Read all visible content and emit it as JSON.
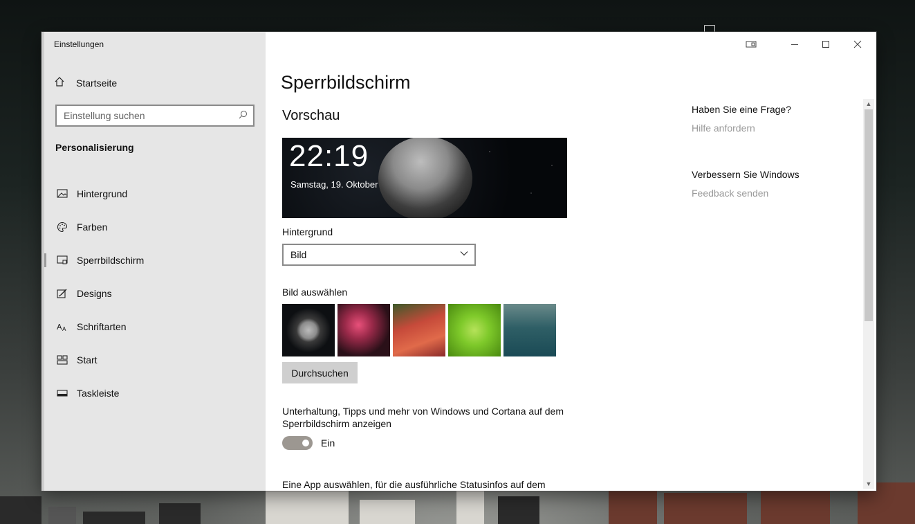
{
  "window": {
    "app_title": "Einstellungen"
  },
  "sidebar": {
    "home_label": "Startseite",
    "search_placeholder": "Einstellung suchen",
    "section_title": "Personalisierung",
    "items": [
      {
        "label": "Hintergrund",
        "icon": "picture-icon",
        "active": false
      },
      {
        "label": "Farben",
        "icon": "palette-icon",
        "active": false
      },
      {
        "label": "Sperrbildschirm",
        "icon": "lock-screen-icon",
        "active": true
      },
      {
        "label": "Designs",
        "icon": "brush-icon",
        "active": false
      },
      {
        "label": "Schriftarten",
        "icon": "font-icon",
        "active": false
      },
      {
        "label": "Start",
        "icon": "start-grid-icon",
        "active": false
      },
      {
        "label": "Taskleiste",
        "icon": "taskbar-icon",
        "active": false
      }
    ]
  },
  "main": {
    "page_title": "Sperrbildschirm",
    "preview_heading": "Vorschau",
    "preview_time": "22:19",
    "preview_date": "Samstag, 19. Oktober",
    "background_label": "Hintergrund",
    "background_value": "Bild",
    "choose_image_label": "Bild auswählen",
    "browse_button": "Durchsuchen",
    "tips_text": "Unterhaltung, Tipps und mehr von Windows und Cortana auf dem Sperrbildschirm anzeigen",
    "tips_toggle_state": "Ein",
    "tips_toggle_on": true,
    "app_status_text": "Eine App auswählen, für die ausführliche Statusinfos auf dem"
  },
  "help": {
    "question_heading": "Haben Sie eine Frage?",
    "question_link": "Hilfe anfordern",
    "improve_heading": "Verbessern Sie Windows",
    "improve_link": "Feedback senden"
  },
  "colors": {
    "sidebar_bg": "#e6e6e6",
    "button_bg": "#cfcfcf",
    "toggle_on": "#9c9791",
    "link_muted": "#9a9a9a"
  }
}
